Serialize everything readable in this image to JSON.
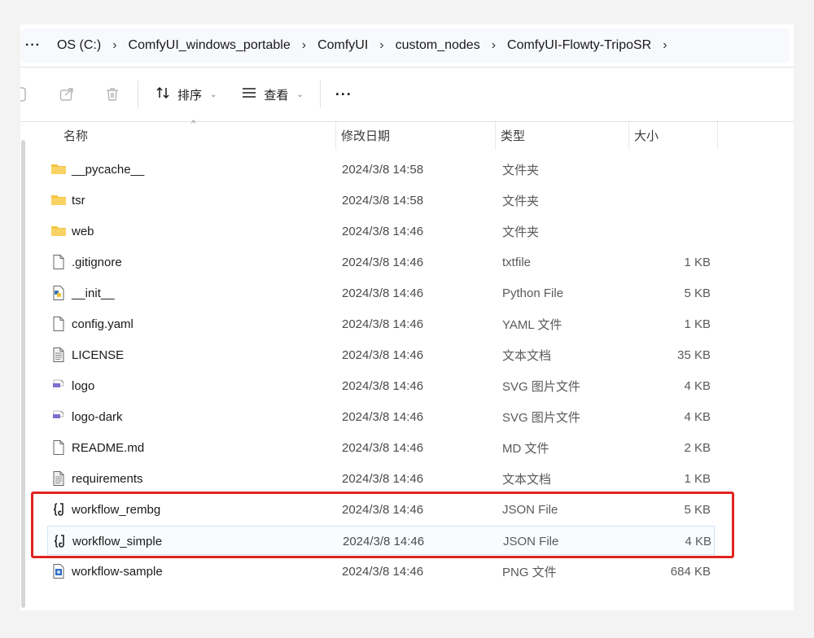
{
  "breadcrumb": {
    "more": "···",
    "items": [
      "OS (C:)",
      "ComfyUI_windows_portable",
      "ComfyUI",
      "custom_nodes",
      "ComfyUI-Flowty-TripoSR"
    ]
  },
  "toolbar": {
    "sort_label": "排序",
    "view_label": "查看",
    "more_label": "···"
  },
  "columns": {
    "name": "名称",
    "modified": "修改日期",
    "type": "类型",
    "size": "大小"
  },
  "files": [
    {
      "name": "__pycache__",
      "date": "2024/3/8 14:58",
      "type": "文件夹",
      "size": "",
      "icon": "folder-icon"
    },
    {
      "name": "tsr",
      "date": "2024/3/8 14:58",
      "type": "文件夹",
      "size": "",
      "icon": "folder-icon"
    },
    {
      "name": "web",
      "date": "2024/3/8 14:46",
      "type": "文件夹",
      "size": "",
      "icon": "folder-icon"
    },
    {
      "name": ".gitignore",
      "date": "2024/3/8 14:46",
      "type": "txtfile",
      "size": "1 KB",
      "icon": "blank-file-icon"
    },
    {
      "name": "__init__",
      "date": "2024/3/8 14:46",
      "type": "Python File",
      "size": "5 KB",
      "icon": "python-file-icon"
    },
    {
      "name": "config.yaml",
      "date": "2024/3/8 14:46",
      "type": "YAML 文件",
      "size": "1 KB",
      "icon": "blank-file-icon"
    },
    {
      "name": "LICENSE",
      "date": "2024/3/8 14:46",
      "type": "文本文档",
      "size": "35 KB",
      "icon": "text-file-icon"
    },
    {
      "name": "logo",
      "date": "2024/3/8 14:46",
      "type": "SVG 图片文件",
      "size": "4 KB",
      "icon": "svg-file-icon"
    },
    {
      "name": "logo-dark",
      "date": "2024/3/8 14:46",
      "type": "SVG 图片文件",
      "size": "4 KB",
      "icon": "svg-file-icon"
    },
    {
      "name": "README.md",
      "date": "2024/3/8 14:46",
      "type": "MD 文件",
      "size": "2 KB",
      "icon": "blank-file-icon"
    },
    {
      "name": "requirements",
      "date": "2024/3/8 14:46",
      "type": "文本文档",
      "size": "1 KB",
      "icon": "text-file-icon"
    },
    {
      "name": "workflow_rembg",
      "date": "2024/3/8 14:46",
      "type": "JSON File",
      "size": "5 KB",
      "icon": "json-file-icon"
    },
    {
      "name": "workflow_simple",
      "date": "2024/3/8 14:46",
      "type": "JSON File",
      "size": "4 KB",
      "icon": "json-file-icon",
      "selected": true
    },
    {
      "name": "workflow-sample",
      "date": "2024/3/8 14:46",
      "type": "PNG 文件",
      "size": "684 KB",
      "icon": "png-file-icon"
    }
  ],
  "colors": {
    "highlight_border": "#e0231f",
    "folder": "#f5c542",
    "selection_border": "#cfe3f7"
  }
}
